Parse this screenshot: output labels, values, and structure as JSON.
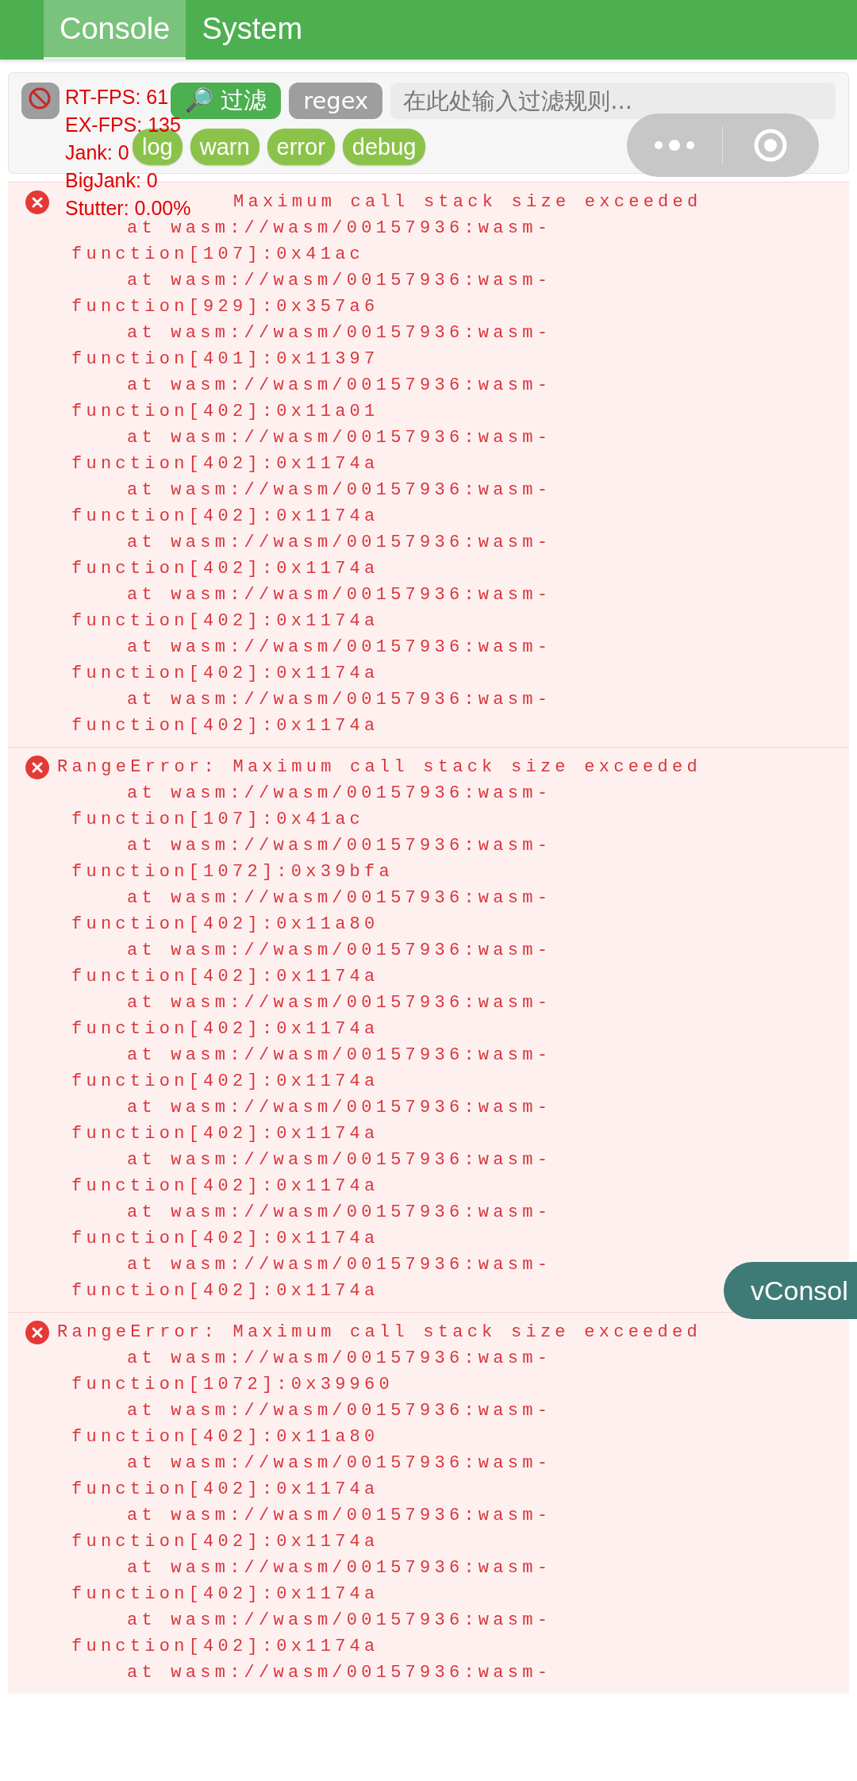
{
  "tabs": [
    {
      "label": "Console",
      "selected": true
    },
    {
      "label": "System",
      "selected": false
    }
  ],
  "toolbar": {
    "filter_button": "🔎 过滤",
    "regex_button": "regex",
    "filter_input": {
      "placeholder": "在此处输入过滤规则..."
    },
    "levels": [
      "log",
      "warn",
      "error",
      "debug"
    ]
  },
  "logs": [
    {
      "message": "Maximum call stack size exceeded",
      "message_head_hidden": true,
      "frames": [
        {
          "location": "at wasm://wasm/00157936:wasm-",
          "function": "function[107]:0x41ac"
        },
        {
          "location": "at wasm://wasm/00157936:wasm-",
          "function": "function[929]:0x357a6"
        },
        {
          "location": "at wasm://wasm/00157936:wasm-",
          "function": "function[401]:0x11397"
        },
        {
          "location": "at wasm://wasm/00157936:wasm-",
          "function": "function[402]:0x11a01"
        },
        {
          "location": "at wasm://wasm/00157936:wasm-",
          "function": "function[402]:0x1174a"
        },
        {
          "location": "at wasm://wasm/00157936:wasm-",
          "function": "function[402]:0x1174a"
        },
        {
          "location": "at wasm://wasm/00157936:wasm-",
          "function": "function[402]:0x1174a"
        },
        {
          "location": "at wasm://wasm/00157936:wasm-",
          "function": "function[402]:0x1174a"
        },
        {
          "location": "at wasm://wasm/00157936:wasm-",
          "function": "function[402]:0x1174a"
        },
        {
          "location": "at wasm://wasm/00157936:wasm-",
          "function": "function[402]:0x1174a"
        }
      ]
    },
    {
      "message": "RangeError: Maximum call stack size exceeded",
      "frames": [
        {
          "location": "at wasm://wasm/00157936:wasm-",
          "function": "function[107]:0x41ac"
        },
        {
          "location": "at wasm://wasm/00157936:wasm-",
          "function": "function[1072]:0x39bfa"
        },
        {
          "location": "at wasm://wasm/00157936:wasm-",
          "function": "function[402]:0x11a80"
        },
        {
          "location": "at wasm://wasm/00157936:wasm-",
          "function": "function[402]:0x1174a"
        },
        {
          "location": "at wasm://wasm/00157936:wasm-",
          "function": "function[402]:0x1174a"
        },
        {
          "location": "at wasm://wasm/00157936:wasm-",
          "function": "function[402]:0x1174a"
        },
        {
          "location": "at wasm://wasm/00157936:wasm-",
          "function": "function[402]:0x1174a"
        },
        {
          "location": "at wasm://wasm/00157936:wasm-",
          "function": "function[402]:0x1174a"
        },
        {
          "location": "at wasm://wasm/00157936:wasm-",
          "function": "function[402]:0x1174a"
        },
        {
          "location": "at wasm://wasm/00157936:wasm-",
          "function": "function[402]:0x1174a"
        }
      ]
    },
    {
      "message": "RangeError: Maximum call stack size exceeded",
      "frames": [
        {
          "location": "at wasm://wasm/00157936:wasm-",
          "function": "function[1072]:0x39960"
        },
        {
          "location": "at wasm://wasm/00157936:wasm-",
          "function": "function[402]:0x11a80"
        },
        {
          "location": "at wasm://wasm/00157936:wasm-",
          "function": "function[402]:0x1174a"
        },
        {
          "location": "at wasm://wasm/00157936:wasm-",
          "function": "function[402]:0x1174a"
        },
        {
          "location": "at wasm://wasm/00157936:wasm-",
          "function": "function[402]:0x1174a"
        },
        {
          "location": "at wasm://wasm/00157936:wasm-",
          "function": "function[402]:0x1174a"
        },
        {
          "location": "at wasm://wasm/00157936:wasm-"
        }
      ]
    }
  ],
  "fps_overlay": [
    "RT-FPS: 61",
    "EX-FPS: 135",
    "Jank: 0",
    "BigJank: 0",
    "Stutter: 0.00%"
  ],
  "vconsole_button": "vConsol"
}
